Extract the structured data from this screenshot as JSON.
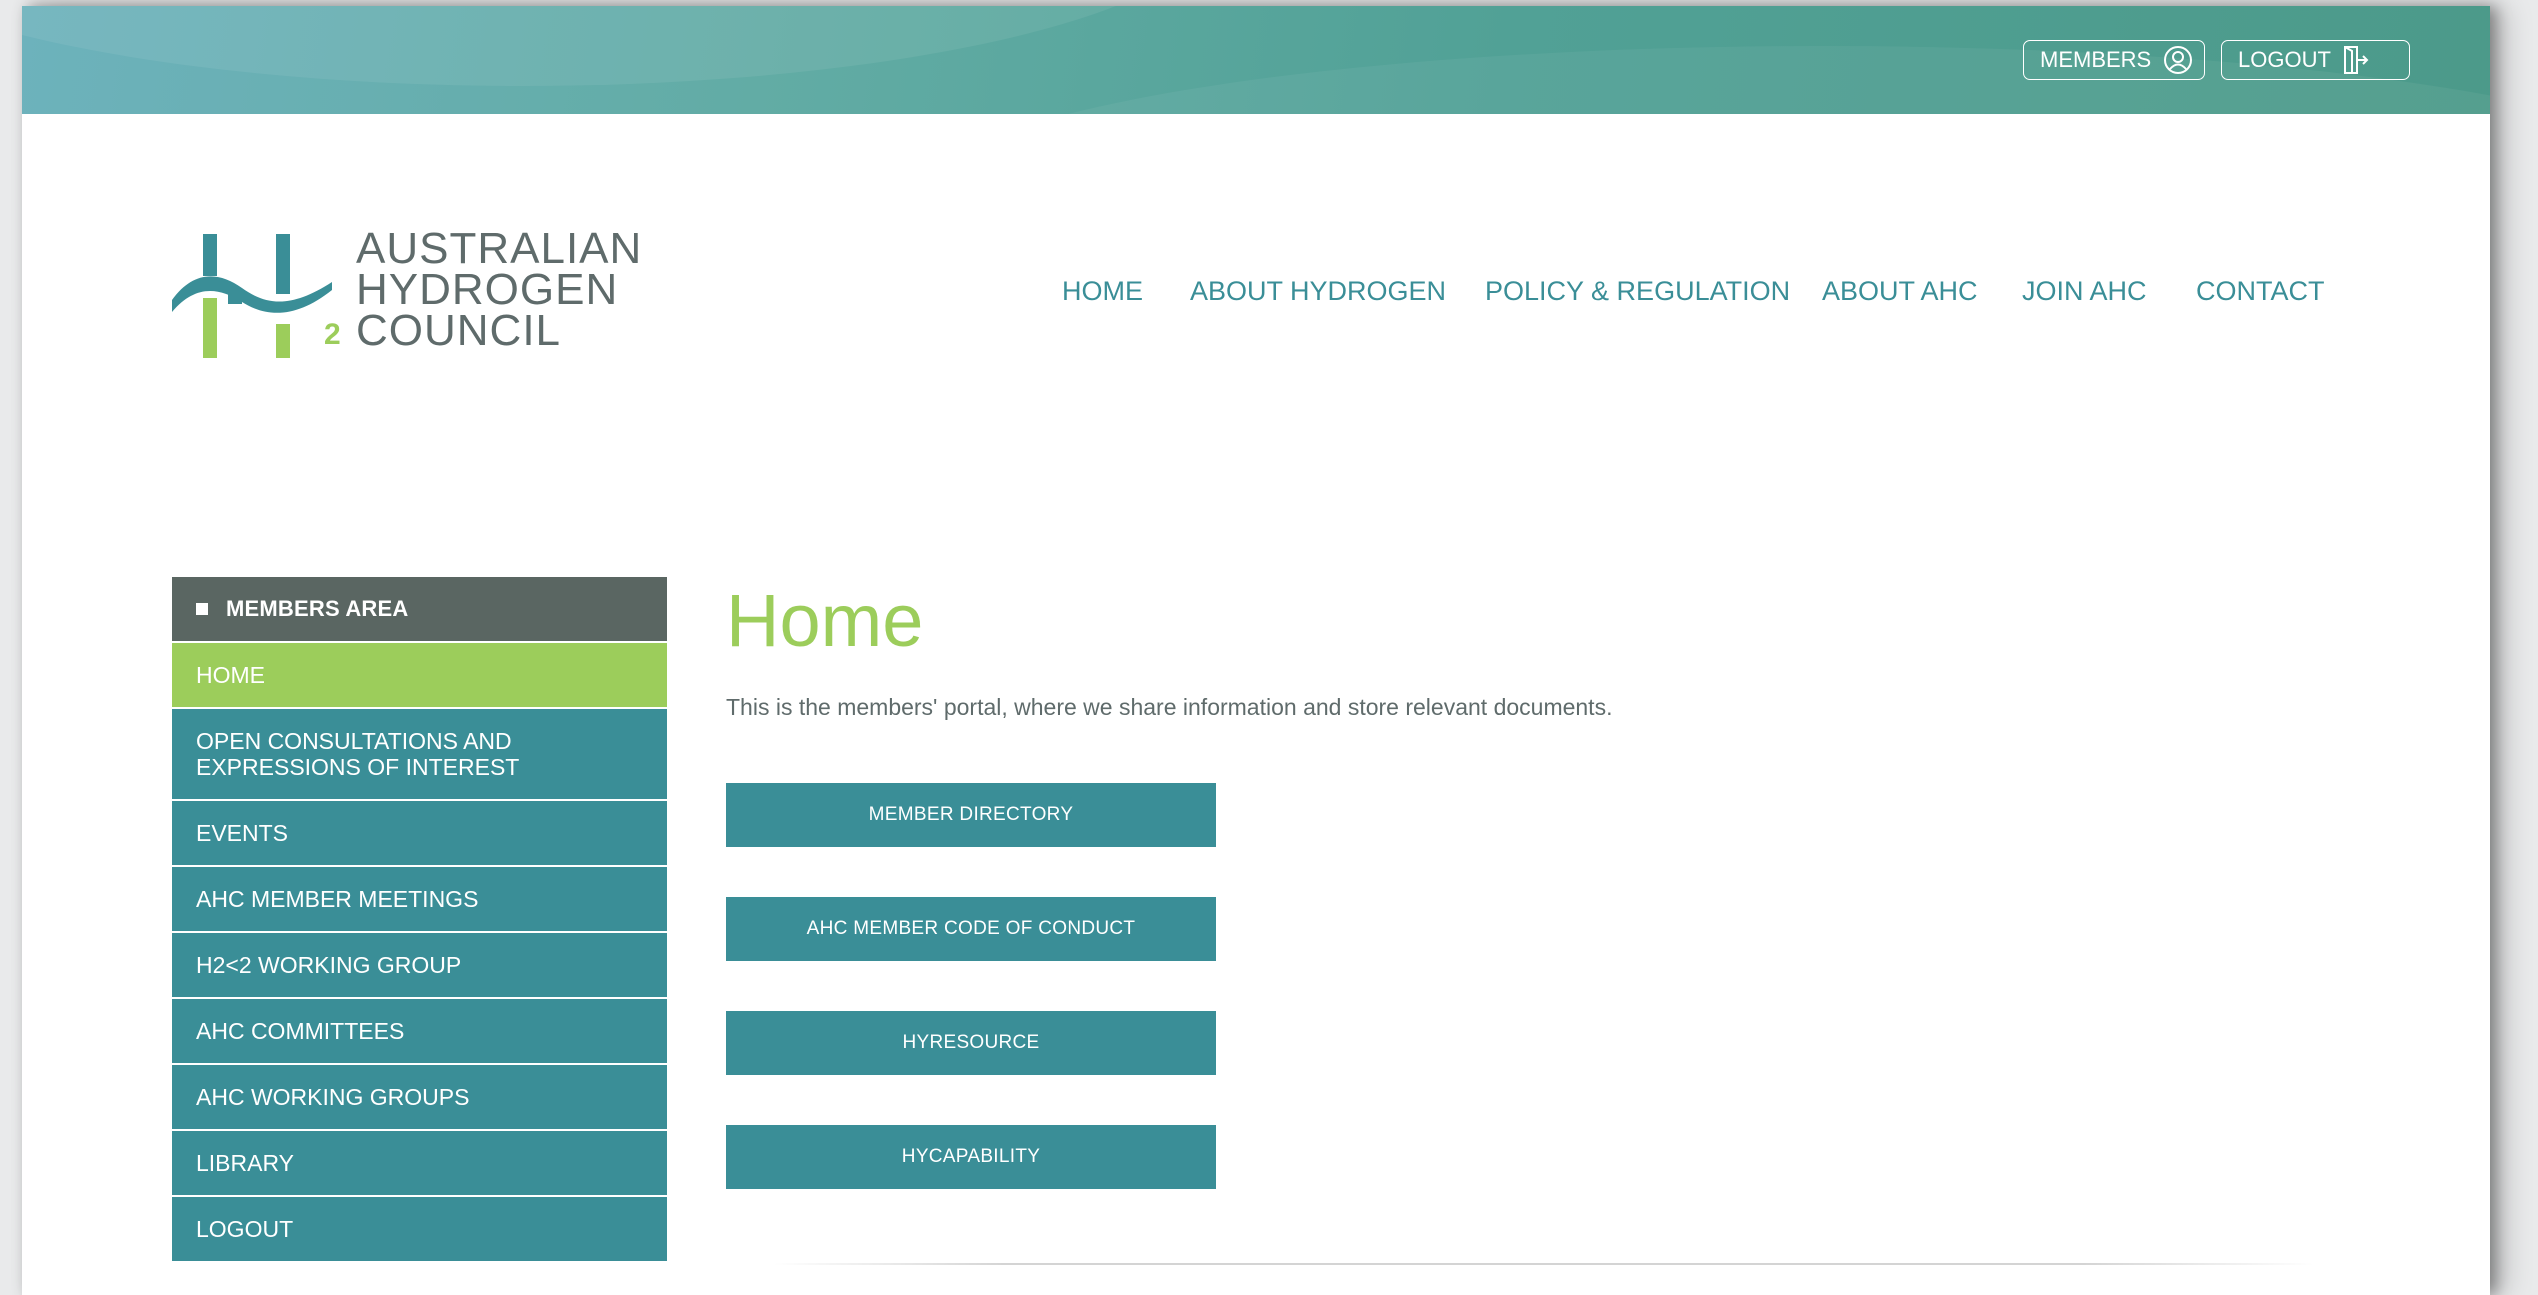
{
  "topbar": {
    "members_label": "MEMBERS",
    "logout_label": "LOGOUT"
  },
  "logo": {
    "lines": [
      "AUSTRALIAN",
      "HYDROGEN",
      "COUNCIL"
    ],
    "mark_subscript": "2"
  },
  "nav": {
    "items": [
      "HOME",
      "ABOUT HYDROGEN",
      "POLICY & REGULATION",
      "ABOUT AHC",
      "JOIN AHC",
      "CONTACT"
    ]
  },
  "sidebar": {
    "heading": "MEMBERS AREA",
    "items": [
      {
        "label": "HOME",
        "active": true
      },
      {
        "label": "OPEN CONSULTATIONS AND",
        "label2": "EXPRESSIONS OF INTEREST"
      },
      {
        "label": "EVENTS"
      },
      {
        "label": "AHC MEMBER MEETINGS"
      },
      {
        "label": "H2<2 WORKING GROUP"
      },
      {
        "label": "AHC COMMITTEES"
      },
      {
        "label": "AHC WORKING GROUPS"
      },
      {
        "label": "LIBRARY"
      },
      {
        "label": "LOGOUT"
      }
    ]
  },
  "main": {
    "title": "Home",
    "intro": "This is the members' portal, where we share information and store relevant documents.",
    "buttons": [
      "MEMBER DIRECTORY",
      "AHC MEMBER CODE OF CONDUCT",
      "HYRESOURCE",
      "HYCAPABILITY"
    ]
  },
  "colors": {
    "teal": "#3a8e97",
    "green": "#9ccd5b",
    "sidebar_heading": "#5a6662",
    "text_grey": "#5f6b6b"
  },
  "icons": [
    "user-circle-icon",
    "logout-door-icon"
  ]
}
